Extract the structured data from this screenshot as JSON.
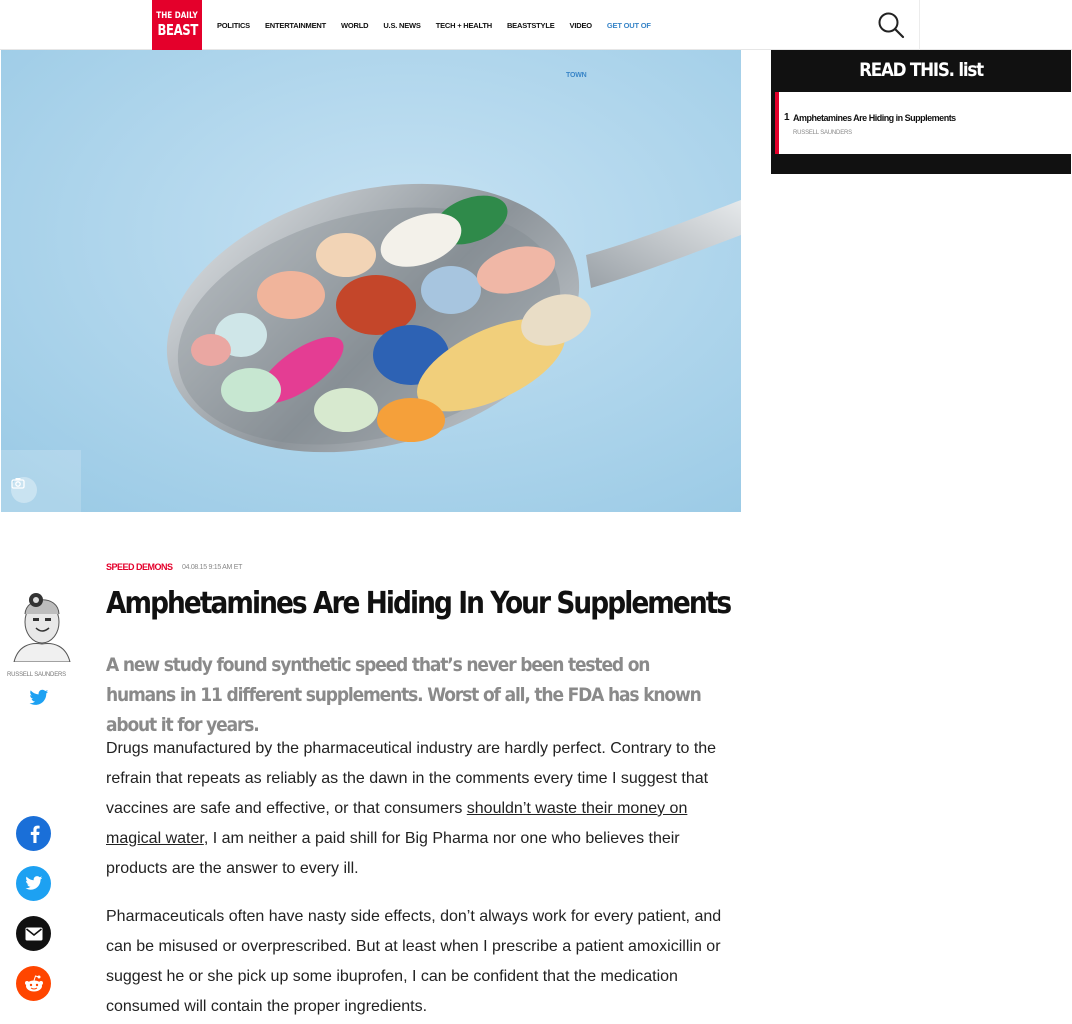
{
  "header": {
    "logo": {
      "line1": "THE DAILY",
      "line2": "BEAST"
    },
    "nav": [
      {
        "label": "POLITICS"
      },
      {
        "label": "ENTERTAINMENT"
      },
      {
        "label": "WORLD"
      },
      {
        "label": "U.S. NEWS"
      },
      {
        "label": "TECH + HEALTH"
      },
      {
        "label": "BEASTSTYLE"
      },
      {
        "label": "VIDEO"
      },
      {
        "label": "GET OUT OF"
      }
    ],
    "nav_overflow": "TOWN",
    "search_icon": "search-icon",
    "accent_color": "#3a86c8",
    "brand_color": "#e4002b"
  },
  "hero": {
    "icon": "camera-icon"
  },
  "sidebar": {
    "title": "READ THIS. list",
    "items": [
      {
        "number": "1",
        "title": "Amphetamines Are Hiding in Supplements",
        "author": "RUSSELL SAUNDERS"
      }
    ]
  },
  "article": {
    "kicker": "SPEED DEMONS",
    "date": "04.08.15 9:15 AM ET",
    "headline": "Amphetamines Are Hiding In Your Supplements",
    "dek": "A new study found synthetic speed that’s never been tested on humans in 11 different supplements. Worst of all, the FDA has known about it for years.",
    "author": {
      "name": "RUSSELL SAUNDERS",
      "twitter_icon": "twitter-icon"
    },
    "paragraphs": [
      {
        "before": "Drugs manufactured by the pharmaceutical industry are hardly perfect. Contrary to the refrain that repeats as reliably as the dawn in the comments every time I suggest that vaccines are safe and effective, or that consumers ",
        "link": "shouldn’t waste their money on magical water",
        "after": ", I am neither a paid shill for Big Pharma nor one who believes their products are the answer to every ill."
      },
      {
        "text": "Pharmaceuticals often have nasty side effects, don’t always work for every patient, and can be misused or overprescribed. But at least when I prescribe a patient amoxicillin or suggest he or she pick up some ibuprofen, I can be confident that the medication consumed will contain the proper ingredients."
      }
    ]
  },
  "share": [
    {
      "icon": "facebook-icon",
      "color": "#1a6fd8"
    },
    {
      "icon": "twitter-icon",
      "color": "#1da1f2"
    },
    {
      "icon": "email-icon",
      "color": "#111111"
    },
    {
      "icon": "reddit-icon",
      "color": "#ff4500"
    }
  ]
}
